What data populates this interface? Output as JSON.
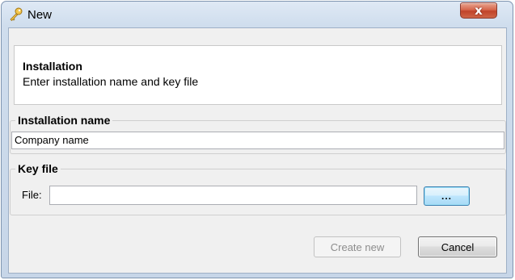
{
  "window": {
    "title": "New",
    "icon": "key-icon",
    "close_label": "x"
  },
  "header": {
    "title": "Installation",
    "description": "Enter installation name and key file"
  },
  "installation_group": {
    "label": "Installation name",
    "name_value": "Company name"
  },
  "key_group": {
    "label": "Key file",
    "file_label": "File:",
    "file_value": "",
    "browse_label": "..."
  },
  "buttons": {
    "create_label": "Create new",
    "create_enabled": false,
    "cancel_label": "Cancel"
  },
  "colors": {
    "close_button": "#c0432a",
    "focus_button": "#a7d9f5",
    "dialog_background": "#f0f0f0"
  }
}
